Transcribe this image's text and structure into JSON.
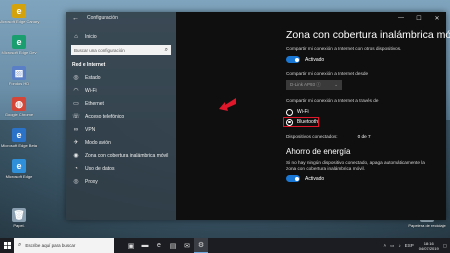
{
  "desktop": {
    "icons_left": [
      {
        "label": "Microsoft Edge Canary",
        "icon": "edge-canary-icon",
        "color": "#d4a20a"
      },
      {
        "label": "Microsoft Edge Dev",
        "icon": "edge-dev-icon",
        "color": "#1b9e6f"
      },
      {
        "label": "Fondos HD",
        "icon": "image-icon",
        "color": "#5b7fc7"
      },
      {
        "label": "Google Chrome",
        "icon": "chrome-icon",
        "color": "#d44638"
      },
      {
        "label": "Microsoft Edge Beta",
        "icon": "edge-beta-icon",
        "color": "#2b73c9"
      },
      {
        "label": "Microsoft Edge",
        "icon": "edge-icon",
        "color": "#2f8fd8"
      },
      {
        "label": "Papel.",
        "icon": "recycle-bin-icon",
        "color": "#8aa0b0"
      }
    ],
    "icon_right": {
      "label": "Papelera de reciclaje",
      "icon": "recycle-bin-icon"
    }
  },
  "window": {
    "app_title": "Configuración",
    "controls": {
      "minimize": "—",
      "maximize": "☐",
      "close": "✕"
    }
  },
  "sidebar": {
    "home_label": "Inicio",
    "search_placeholder": "Buscar una configuración",
    "section_title": "Red e Internet",
    "items": [
      {
        "label": "Estado",
        "icon": "globe-icon"
      },
      {
        "label": "Wi-Fi",
        "icon": "wifi-icon"
      },
      {
        "label": "Ethernet",
        "icon": "ethernet-icon"
      },
      {
        "label": "Acceso telefónico",
        "icon": "dialup-icon"
      },
      {
        "label": "VPN",
        "icon": "vpn-icon"
      },
      {
        "label": "Modo avión",
        "icon": "airplane-icon"
      },
      {
        "label": "Zona con cobertura inalámbrica móvil",
        "icon": "hotspot-icon"
      },
      {
        "label": "Uso de datos",
        "icon": "data-usage-icon"
      },
      {
        "label": "Proxy",
        "icon": "globe-icon"
      }
    ]
  },
  "main": {
    "title": "Zona con cobertura inalámbrica móvil",
    "share_desc": "Compartir mi conexión a Internet con otros dispositivos.",
    "share_toggle": "Activado",
    "share_from_label": "Compartir mi conexión a Internet desde",
    "share_from_value": "D-Link   AP93  ⓘ",
    "share_via_label": "Compartir mi conexión a Internet a través de",
    "options": [
      {
        "label": "Wi-Fi",
        "selected": false
      },
      {
        "label": "Bluetooth",
        "selected": true
      }
    ],
    "devices_label": "Dispositivos conectados:",
    "devices_value": "0 de 7",
    "power_title": "Ahorro de energía",
    "power_desc_1": "Si no hay ningún dispositivo conectado, apaga automáticamente la",
    "power_desc_2": "zona con cobertura inalámbrica móvil.",
    "power_toggle": "Activado",
    "accent_color": "#1a78d4",
    "highlight_color": "#e0162b"
  },
  "taskbar": {
    "search_placeholder": "Escribe aquí para buscar",
    "apps": [
      "task-view-icon",
      "explorer-icon",
      "edge-icon",
      "store-icon",
      "mail-icon",
      "settings-icon"
    ],
    "tray_lang": "ESP",
    "time": "18:16",
    "date": "04/07/2019"
  }
}
